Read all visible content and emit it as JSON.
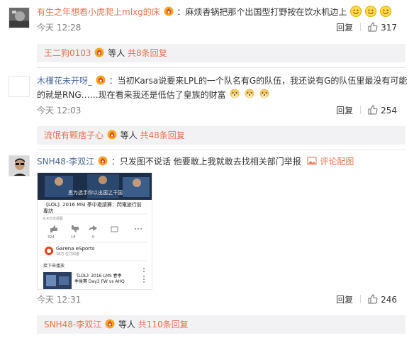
{
  "comments": [
    {
      "user": "有生之年想看小虎爬上mlxg的床",
      "text": "：麻烦香锅把那个出国型打野按在饮水机边上",
      "time": "今天 12:28",
      "reply_label": "回复",
      "likes": "317",
      "reply_summary": {
        "who": "王二狗0103",
        "etc": "等人",
        "more": "共8条回复"
      }
    },
    {
      "user": "木槿花未开呀_",
      "text_line1": "：当初Karsa说要来LPL的一个队名有G的队伍，我还说有G的队伍里最没有可能",
      "text_line2": "的就是RNG……现在看来我还是低估了皇族的财富",
      "time": "今天 12:03",
      "reply_label": "回复",
      "likes": "254",
      "reply_summary": {
        "who": "流氓有颗痞子心",
        "etc": "等人",
        "more": "共48条回复"
      }
    },
    {
      "user": "SNH48-李双江",
      "text": "：只发图不说话 他要敢上我就敢去找相关部门举报",
      "image_link": "评论配图",
      "time": "今天 12:31",
      "reply_label": "回复",
      "likes": "246",
      "reply_summary": {
        "who": "SNH48-李双江",
        "etc": "等人",
        "more": "共110条回复"
      },
      "image": {
        "caption": "思为选手你以出国之干国",
        "video_title_line1": "《LOL》2016 MSI 季中邀請賽：閃電旅行前",
        "video_title_line2": "專訪",
        "views": "6.4万次观看",
        "like_count": "324",
        "dislike_count": "14",
        "share_count": "0",
        "channel": "Garena eSports",
        "subscribers": "38万 位订阅者",
        "next_label": "接下来播放",
        "next_title_line1": "《LOL》2016 LMS 春季",
        "next_title_line2": "季後賽 Day3 FW vs AHQ"
      }
    }
  ],
  "colors": {
    "username": "#eb7350",
    "link": "#eb7350",
    "time": "#808080",
    "reply_bg": "#f2f2f5"
  }
}
